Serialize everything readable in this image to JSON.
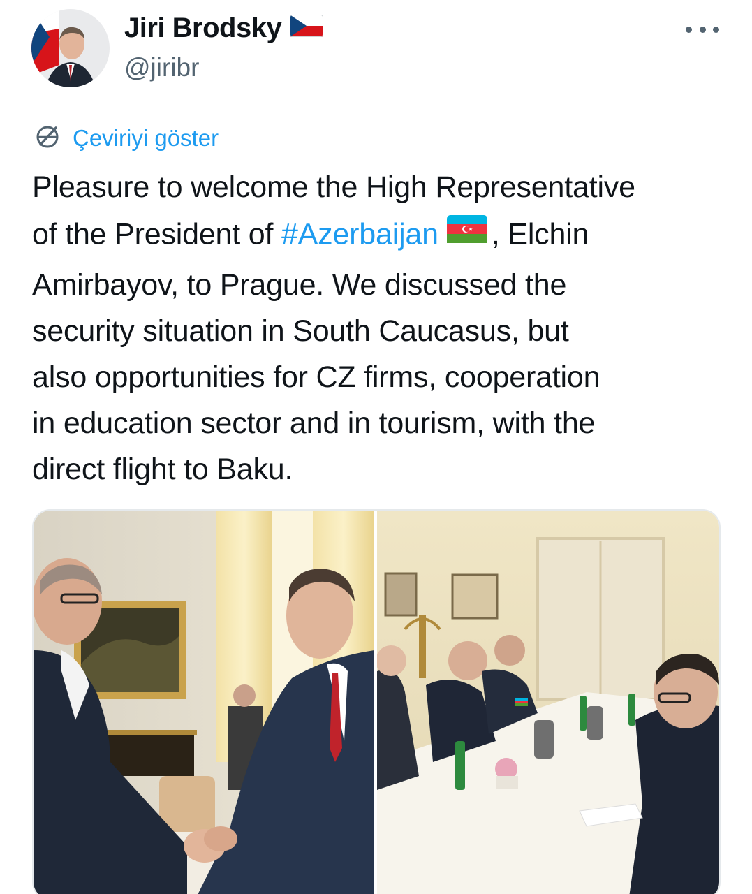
{
  "author": {
    "name": "Jiri Brodsky",
    "handle": "@jiribr",
    "flag_icon": "czech-flag-icon"
  },
  "menu": {
    "icon": "more-horizontal-icon"
  },
  "translate": {
    "icon": "translate-globe-icon",
    "label": "Çeviriyi göster"
  },
  "tweet": {
    "line1": "Pleasure to welcome the High Representative",
    "line2_prefix": "of the President of ",
    "hashtag": "#Azerbaijan",
    "line2_suffix": ", Elchin",
    "line3": "Amirbayov, to Prague. We discussed the",
    "line4": "security situation in South Caucasus, but",
    "line5": "also opportunities for CZ firms, cooperation",
    "line6": "in education sector and in tourism, with the",
    "line7": "direct flight to Baku.",
    "hashtag_flag_icon": "azerbaijan-flag-icon"
  },
  "media": [
    {
      "name": "handshake-photo"
    },
    {
      "name": "meeting-table-photo"
    }
  ],
  "colors": {
    "link": "#1d9bf0",
    "secondary_text": "#536471",
    "primary_text": "#0f1419"
  }
}
